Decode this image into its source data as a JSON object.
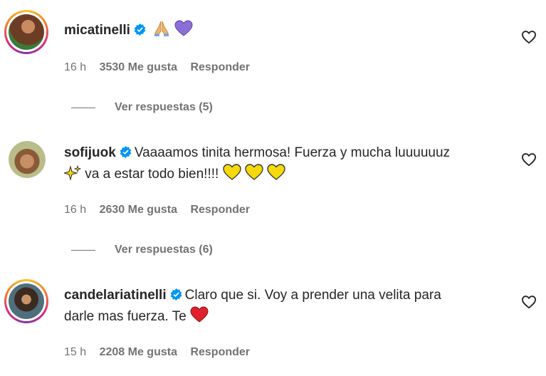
{
  "comments": [
    {
      "username": "micatinelli",
      "text": "",
      "emojis": [
        "folded-hands",
        "purple-heart"
      ],
      "time": "16 h",
      "likes": "3530 Me gusta",
      "reply_label": "Responder",
      "replies_label": "Ver respuestas (5)"
    },
    {
      "username": "sofijuok",
      "text": "Vaaaamos tinita hermosa! Fuerza y mucha luuuuuuz",
      "text2": "va a estar todo bien!!!!",
      "emojis": [
        "sparkles",
        "yellow-heart",
        "yellow-heart",
        "yellow-heart"
      ],
      "time": "16 h",
      "likes": "2630 Me gusta",
      "reply_label": "Responder",
      "replies_label": "Ver respuestas (6)"
    },
    {
      "username": "candelariatinelli",
      "text": "Claro que si. Voy a prender una velita para",
      "text2": "darle mas fuerza. Te",
      "emojis": [
        "red-heart"
      ],
      "time": "15 h",
      "likes": "2208 Me gusta",
      "reply_label": "Responder"
    }
  ],
  "colors": {
    "text": "#262626",
    "secondary": "#737373",
    "verified": "#0095f6",
    "yellow_heart": "#f5d90a",
    "red_heart": "#e0202b",
    "purple_heart": "#8b6fd6"
  }
}
